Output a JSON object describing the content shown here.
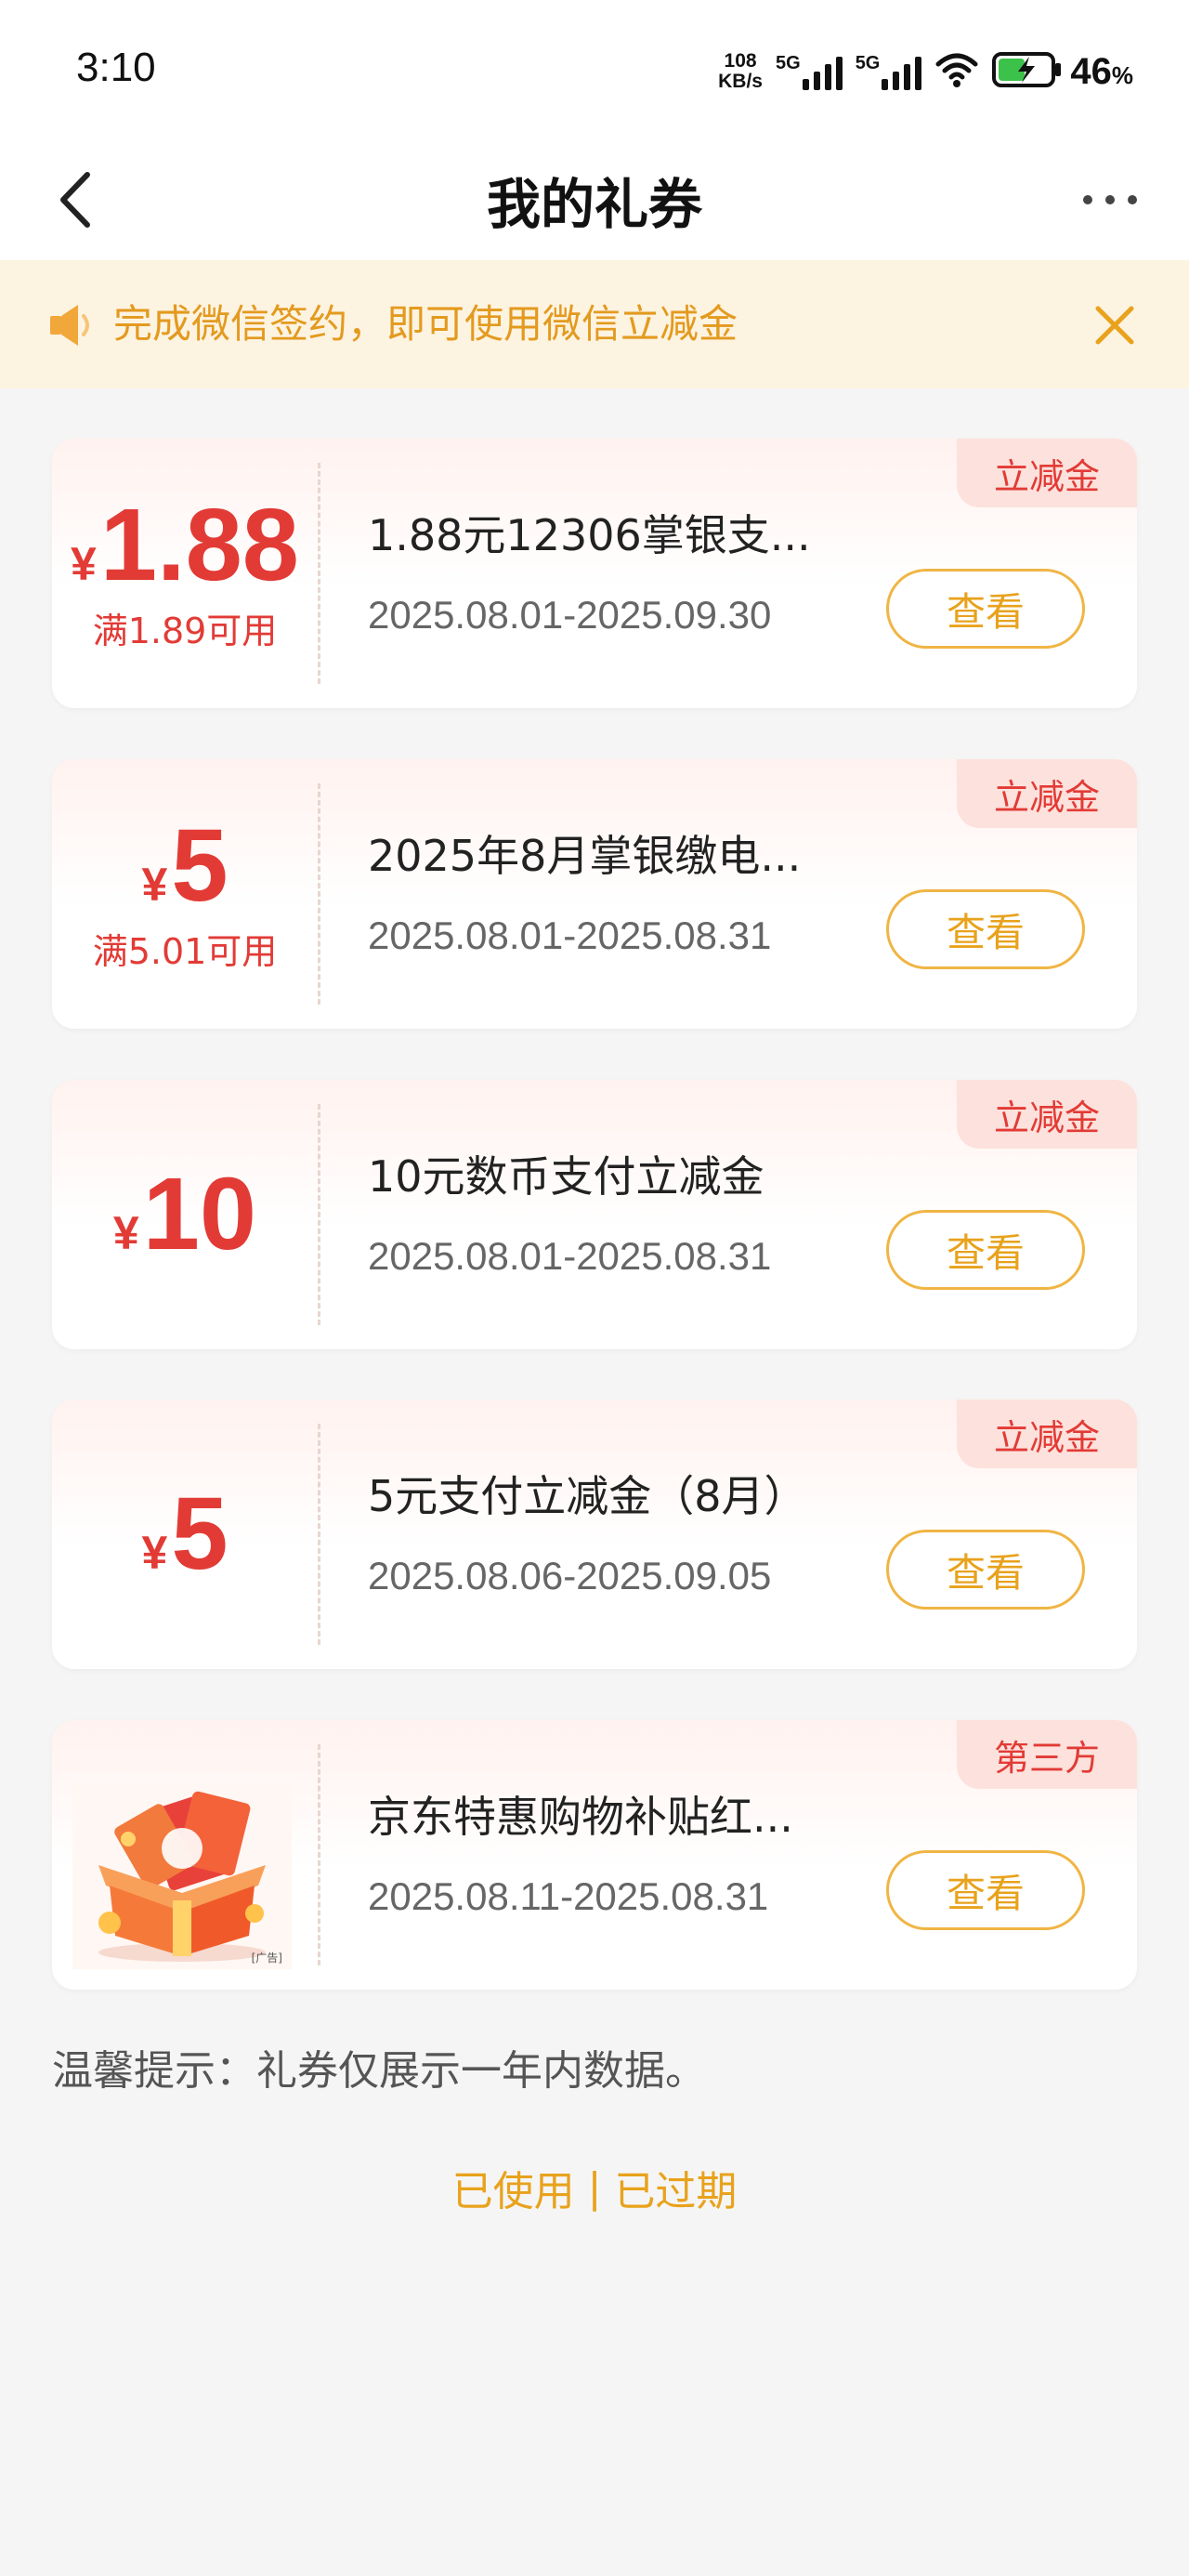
{
  "status_bar": {
    "time": "3:10",
    "net_speed_value": "108",
    "net_speed_unit": "KB/s",
    "signal1_label": "5G",
    "signal2_label": "5G",
    "battery_percent": "46",
    "battery_unit": "%"
  },
  "header": {
    "title": "我的礼券"
  },
  "notice": {
    "text": "完成微信签约，即可使用微信立减金"
  },
  "coupons": [
    {
      "currency": "¥",
      "amount": "1.88",
      "condition": "满1.89可用",
      "name": "1.88元12306掌银支...",
      "date_range": "2025.08.01-2025.09.30",
      "tag": "立减金",
      "action": "查看"
    },
    {
      "currency": "¥",
      "amount": "5",
      "condition": "满5.01可用",
      "name": "2025年8月掌银缴电...",
      "date_range": "2025.08.01-2025.08.31",
      "tag": "立减金",
      "action": "查看"
    },
    {
      "currency": "¥",
      "amount": "10",
      "condition": "",
      "name": "10元数币支付立减金",
      "date_range": "2025.08.01-2025.08.31",
      "tag": "立减金",
      "action": "查看"
    },
    {
      "currency": "¥",
      "amount": "5",
      "condition": "",
      "name": "5元支付立减金（8月）",
      "date_range": "2025.08.06-2025.09.05",
      "tag": "立减金",
      "action": "查看"
    },
    {
      "image_label": "[广告]",
      "name": "京东特惠购物补贴红...",
      "date_range": "2025.08.11-2025.08.31",
      "tag": "第三方",
      "action": "查看"
    }
  ],
  "tip": "温馨提示：礼券仅展示一年内数据。",
  "footer": {
    "used": "已使用",
    "separator": "|",
    "expired": "已过期"
  },
  "colors": {
    "accent_red": "#e23b36",
    "accent_orange": "#e8a21c",
    "notice_bg": "#fdf3e1",
    "tag_bg": "#fde1dc"
  }
}
